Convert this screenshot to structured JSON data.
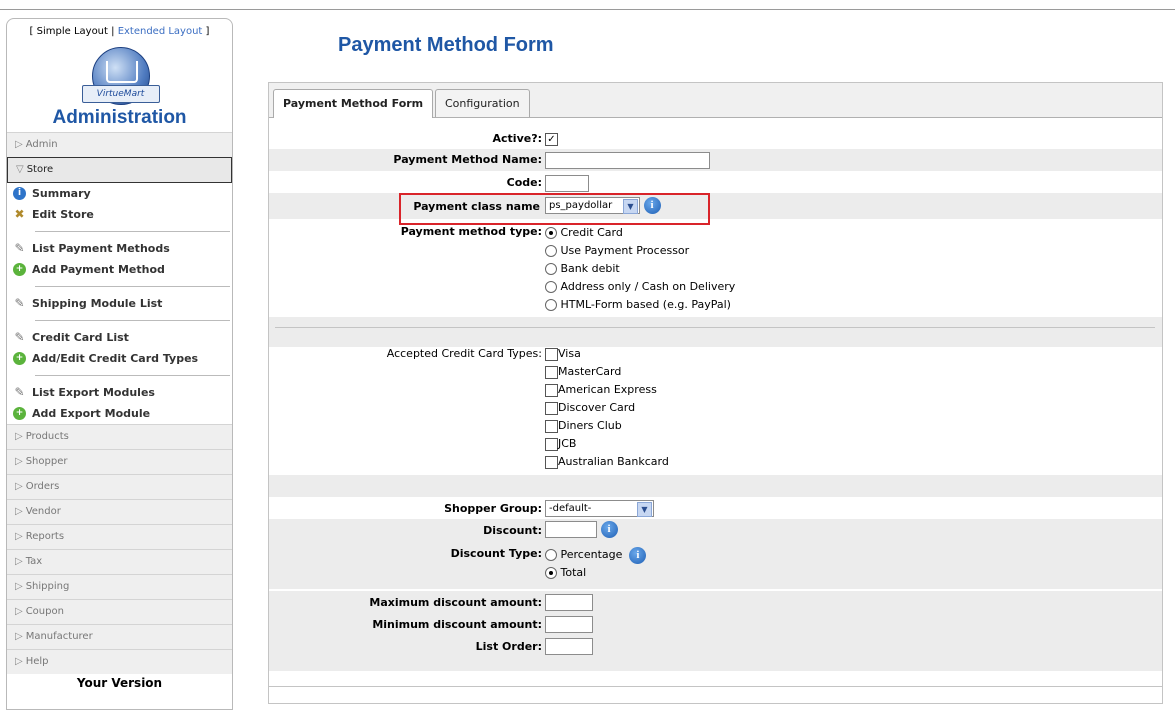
{
  "sidebar": {
    "layout_prefix": "[ ",
    "simple_layout": "Simple Layout",
    "divider": " | ",
    "extended_layout": "Extended Layout",
    "layout_suffix": " ]",
    "logo_text": "VirtueMart",
    "title": "Administration",
    "categories_top": [
      {
        "label": "Admin"
      },
      {
        "label": "Store"
      }
    ],
    "store_items": {
      "summary": "Summary",
      "edit_store": "Edit Store",
      "list_payment": "List Payment Methods",
      "add_payment": "Add Payment Method",
      "shipping_module_list": "Shipping Module List",
      "credit_card_list": "Credit Card List",
      "add_edit_cc": "Add/Edit Credit Card Types",
      "list_export": "List Export Modules",
      "add_export": "Add Export Module"
    },
    "categories_bottom": [
      {
        "label": "Products"
      },
      {
        "label": "Shopper"
      },
      {
        "label": "Orders"
      },
      {
        "label": "Vendor"
      },
      {
        "label": "Reports"
      },
      {
        "label": "Tax"
      },
      {
        "label": "Shipping"
      },
      {
        "label": "Coupon"
      },
      {
        "label": "Manufacturer"
      },
      {
        "label": "Help"
      }
    ],
    "your_version": "Your Version"
  },
  "main": {
    "page_title": "Payment Method Form",
    "tabs": [
      {
        "label": "Payment Method Form"
      },
      {
        "label": "Configuration"
      }
    ],
    "form": {
      "active_label": "Active?:",
      "active_checked": true,
      "name_label": "Payment Method Name:",
      "name_value": "",
      "code_label": "Code:",
      "code_value": "",
      "class_label": "Payment class name",
      "class_value": "ps_paydollar",
      "type_label": "Payment method type:",
      "type_options": [
        "Credit Card",
        "Use Payment Processor",
        "Bank debit",
        "Address only / Cash on Delivery",
        "HTML-Form based (e.g. PayPal)"
      ],
      "type_selected": 0,
      "cc_label": "Accepted Credit Card Types:",
      "cc_options": [
        "Visa",
        "MasterCard",
        "American Express",
        "Discover Card",
        "Diners Club",
        "JCB",
        "Australian Bankcard"
      ],
      "shopper_group_label": "Shopper Group:",
      "shopper_group_value": "-default-",
      "discount_label": "Discount:",
      "discount_value": "",
      "discount_type_label": "Discount Type:",
      "discount_type_options": [
        "Percentage",
        "Total"
      ],
      "discount_type_selected": 1,
      "max_discount_label": "Maximum discount amount:",
      "min_discount_label": "Minimum discount amount:",
      "list_order_label": "List Order:"
    }
  },
  "colors": {
    "title_blue": "#1f57a5",
    "highlight_red": "#d9242a",
    "row_gray": "#ececec"
  }
}
